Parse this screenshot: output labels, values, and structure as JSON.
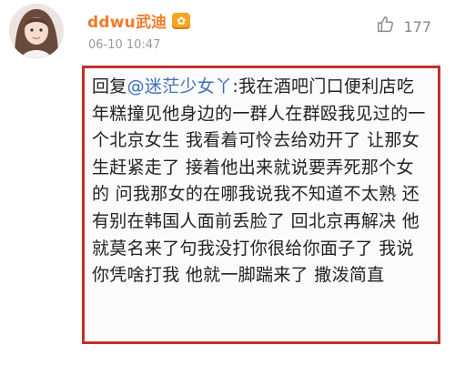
{
  "post": {
    "username": "ddwu武迪",
    "badge_icon": "vip-badge-icon",
    "timestamp": "06-10 10:47",
    "like_icon": "thumbs-up-icon",
    "like_count": "177"
  },
  "comment": {
    "reply_prefix": "回复",
    "mention": "@迷茫少女丫",
    "separator": ":",
    "body": "我在酒吧门口便利店吃年糕撞见他身边的一群人在群殴我见过的一个北京女生 我看着可怜去给劝开了 让那女生赶紧走了 接着他出来就说要弄死那个女的 问我那女的在哪我说我不知道不太熟 还有别在韩国人面前丢脸了 回北京再解决 他就莫名来了句我没打你很给你面子了 我说你凭啥打我 他就一脚踹来了 撒泼简直"
  },
  "colors": {
    "username": "#f07c2b",
    "mention": "#3f6fb5",
    "highlight_border": "#c4302b",
    "muted_text": "#9a9a9a"
  }
}
